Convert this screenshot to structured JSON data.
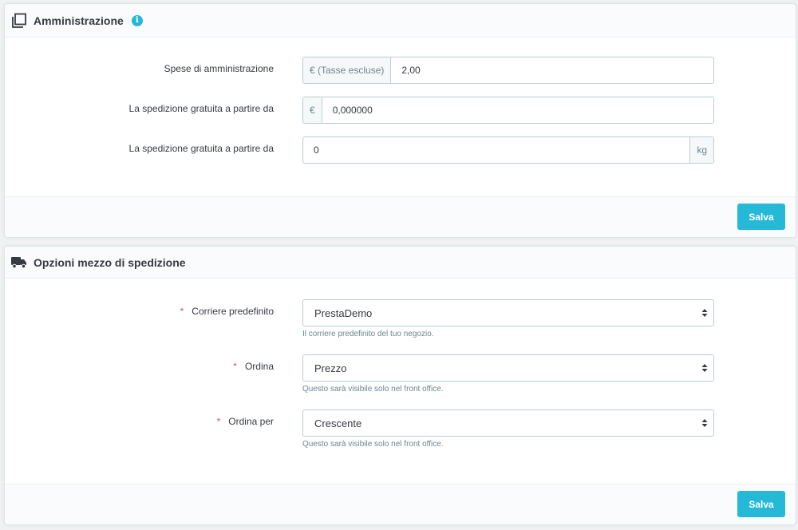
{
  "admin_panel": {
    "title": "Amministrazione",
    "info_icon": "i",
    "fields": [
      {
        "label": "Spese di amministrazione",
        "prefix": "€ (Tasse escluse)",
        "value": "2,00"
      },
      {
        "label": "La spedizione gratuita a partire da",
        "prefix": "€",
        "value": "0,000000"
      },
      {
        "label": "La spedizione gratuita a partire da",
        "suffix": "kg",
        "value": "0"
      }
    ],
    "save_label": "Salva"
  },
  "carrier_panel": {
    "title": "Opzioni mezzo di spedizione",
    "required_mark": "*",
    "fields": [
      {
        "label": "Corriere predefinito",
        "value": "PrestaDemo",
        "help": "Il corriere predefinito del tuo negozio."
      },
      {
        "label": "Ordina",
        "value": "Prezzo",
        "help": "Questo sarà visibile solo nel front office."
      },
      {
        "label": "Ordina per",
        "value": "Crescente",
        "help": "Questo sarà visibile solo nel front office."
      }
    ],
    "save_label": "Salva"
  },
  "colors": {
    "accent": "#25b9d7",
    "required": "#c05c67",
    "border": "#bbcdd2"
  },
  "icons": {
    "admin_heading": "copy-icon",
    "carrier_heading": "truck-icon",
    "select_caret": "sort-icon"
  }
}
